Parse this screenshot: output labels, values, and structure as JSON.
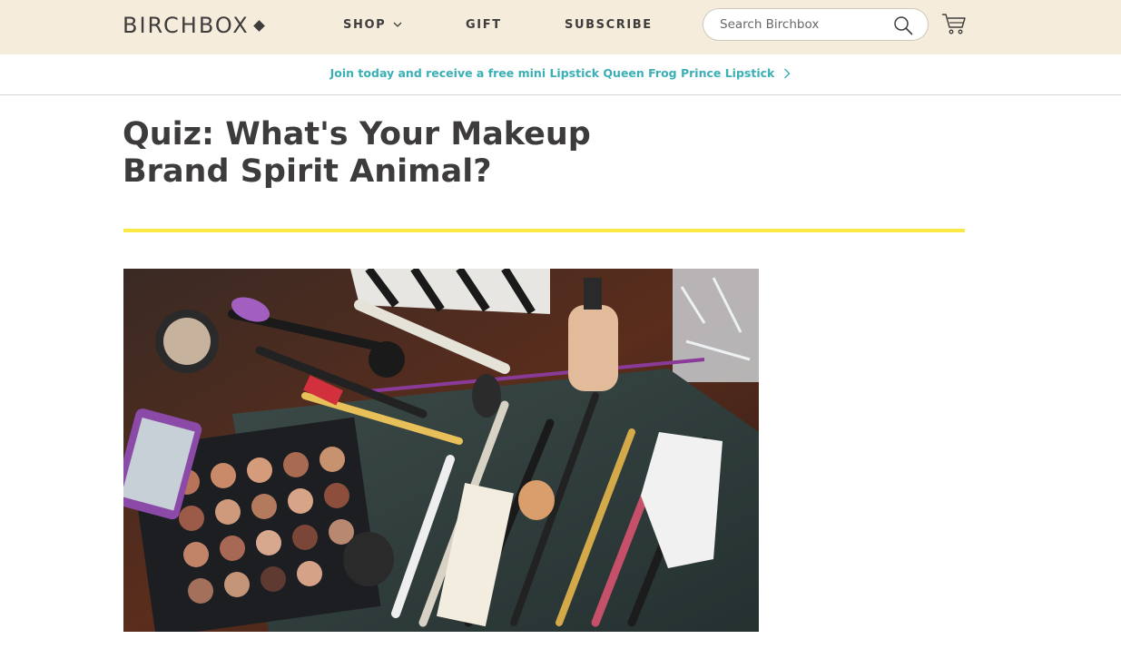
{
  "header": {
    "logo": "BIRCHBOX",
    "nav": [
      {
        "label": "SHOP",
        "has_dropdown": true
      },
      {
        "label": "GIFT"
      },
      {
        "label": "SUBSCRIBE"
      }
    ],
    "search": {
      "placeholder": "Search Birchbox",
      "icon": "search-icon"
    },
    "cart": {
      "icon": "cart-icon"
    },
    "colors": {
      "background": "#f6ecdc",
      "text": "#3e3c3c"
    }
  },
  "promo": {
    "text": "Join today and receive a free mini Lipstick Queen Frog Prince Lipstick",
    "icon": "chevron-right-icon",
    "color": "#3ab0b6"
  },
  "article": {
    "title": "Quiz: What's Your Makeup Brand Spirit Animal?",
    "rule_color": "#fbe946",
    "hero_image": "makeup-brushes-palette-photo"
  }
}
